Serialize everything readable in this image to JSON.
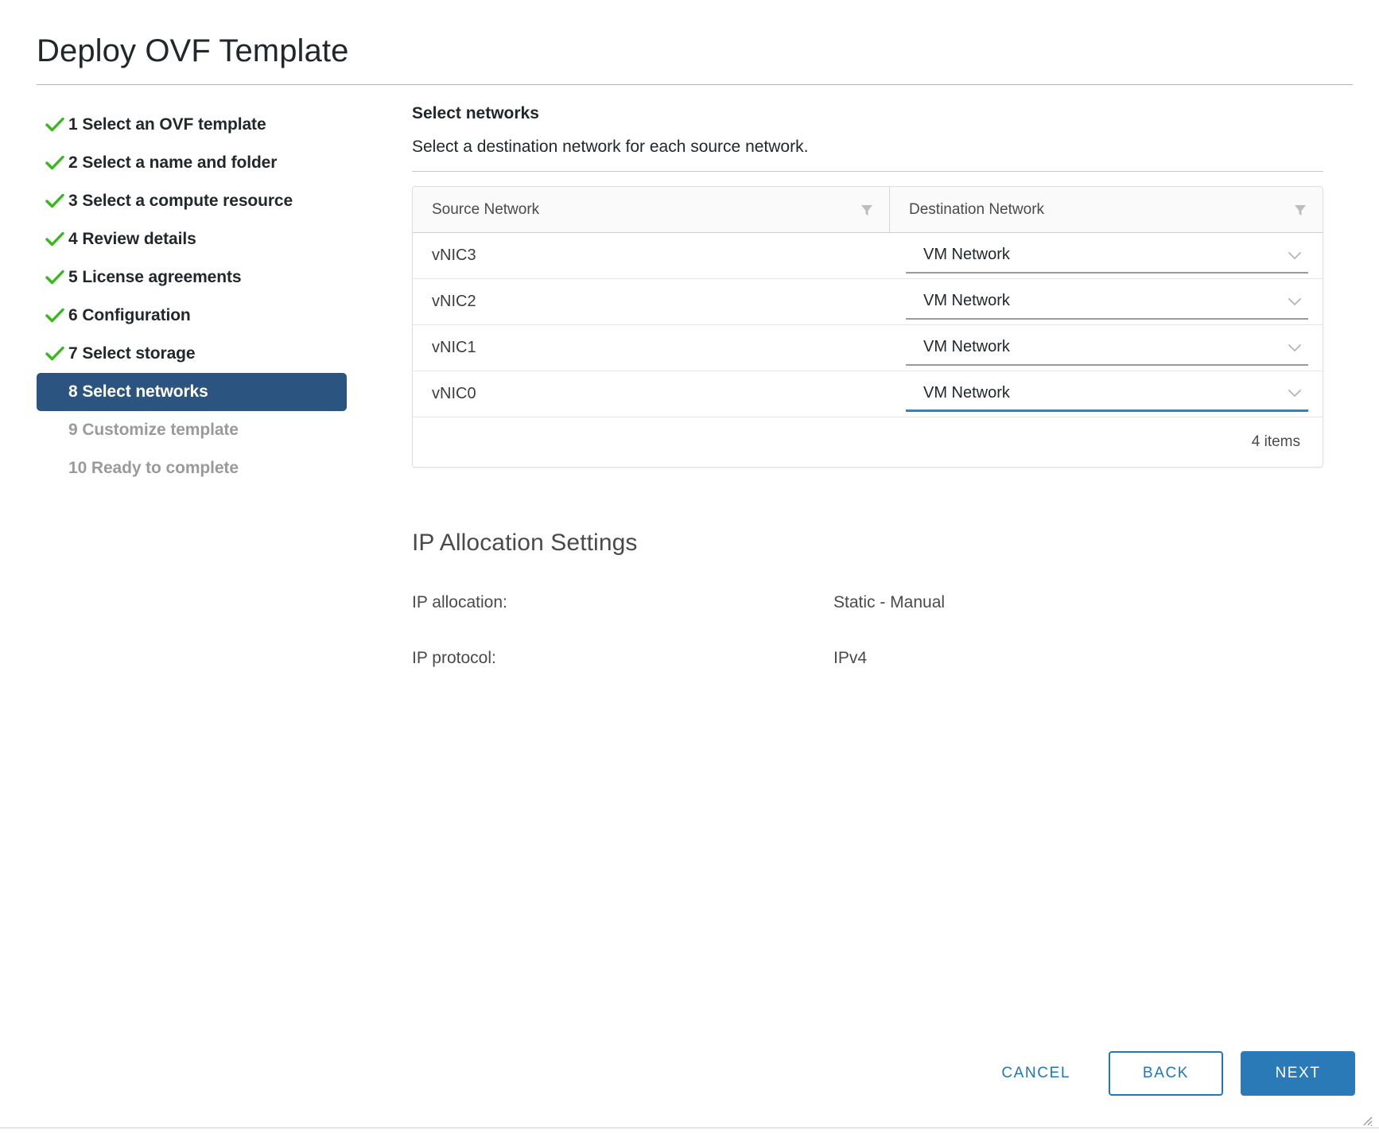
{
  "window": {
    "title": "Deploy OVF Template"
  },
  "steps": [
    {
      "number": "1",
      "label": "1 Select an OVF template",
      "state": "done"
    },
    {
      "number": "2",
      "label": "2 Select a name and folder",
      "state": "done"
    },
    {
      "number": "3",
      "label": "3 Select a compute resource",
      "state": "done"
    },
    {
      "number": "4",
      "label": "4 Review details",
      "state": "done"
    },
    {
      "number": "5",
      "label": "5 License agreements",
      "state": "done"
    },
    {
      "number": "6",
      "label": "6 Configuration",
      "state": "done"
    },
    {
      "number": "7",
      "label": "7 Select storage",
      "state": "done"
    },
    {
      "number": "8",
      "label": "8 Select networks",
      "state": "current"
    },
    {
      "number": "9",
      "label": "9 Customize template",
      "state": "pending"
    },
    {
      "number": "10",
      "label": "10 Ready to complete",
      "state": "pending"
    }
  ],
  "main": {
    "heading": "Select networks",
    "description": "Select a destination network for each source network."
  },
  "table": {
    "columns": {
      "source": "Source Network",
      "destination": "Destination Network"
    },
    "rows": [
      {
        "source": "vNIC3",
        "destination": "VM Network",
        "focused": false
      },
      {
        "source": "vNIC2",
        "destination": "VM Network",
        "focused": false
      },
      {
        "source": "vNIC1",
        "destination": "VM Network",
        "focused": false
      },
      {
        "source": "vNIC0",
        "destination": "VM Network",
        "focused": true
      }
    ],
    "footer_count": "4 items"
  },
  "ip_allocation": {
    "title": "IP Allocation Settings",
    "allocation_label": "IP allocation:",
    "allocation_value": "Static - Manual",
    "protocol_label": "IP protocol:",
    "protocol_value": "IPv4"
  },
  "footer": {
    "cancel": "CANCEL",
    "back": "BACK",
    "next": "NEXT"
  },
  "colors": {
    "accent_blue": "#2078b8",
    "primary_button": "#2b7ab8",
    "current_step_bg": "#2b5580",
    "check_green": "#3cb521",
    "focus_underline": "#1f8ac7"
  }
}
